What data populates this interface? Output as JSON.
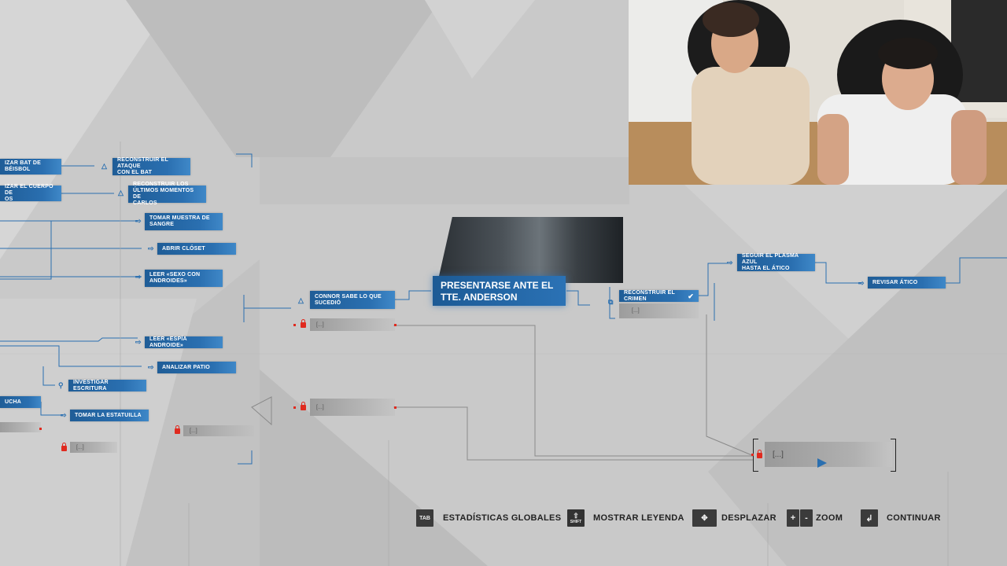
{
  "nodes": {
    "bat": "IZAR BAT DE BÉISBOL",
    "attack": "RECONSTRUIR EL ATAQUE\nCON EL BAT",
    "body": "IZAR EL CUERPO DE\nOS",
    "carlos": "RECONSTRUIR LOS\nÚLTIMOS MOMENTOS DE\nCARLOS",
    "blood": "TOMAR MUESTRA DE\nSANGRE",
    "closet": "ABRIR CLÓSET",
    "sexo": "LEER «SEXO CON\nANDROIDES»",
    "espia": "LEER «ESPÍA ANDROIDE»",
    "patio": "ANALIZAR PATIO",
    "escritura": "INVESTIGAR ESCRITURA",
    "ducha": "UCHA",
    "estatuilla": "TOMAR LA ESTATUILLA",
    "connor": "CONNOR SABE LO QUE\nSUCEDIÓ",
    "main": "PRESENTARSE ANTE EL\nTTE. ANDERSON",
    "crimen": "RECONSTRUIR EL CRIMEN",
    "plasma": "SEGUIR EL PLASMA AZUL\nHASTA EL ÁTICO",
    "atico": "REVISAR ÁTICO"
  },
  "locked_text": "[...]",
  "hud": {
    "tab_key": "TAB",
    "tab_label": "ESTADÍSTICAS GLOBALES",
    "shift_key": "SHIFT",
    "legend_label": "MOSTRAR LEYENDA",
    "move_label": "DESPLAZAR",
    "zoom_plus": "+",
    "zoom_minus": "-",
    "zoom_label": "ZOOM",
    "continue_label": "CONTINUAR"
  },
  "colors": {
    "accent": "#2a6fb0",
    "lock": "#e02a1f",
    "background": "#c9c9c9"
  }
}
